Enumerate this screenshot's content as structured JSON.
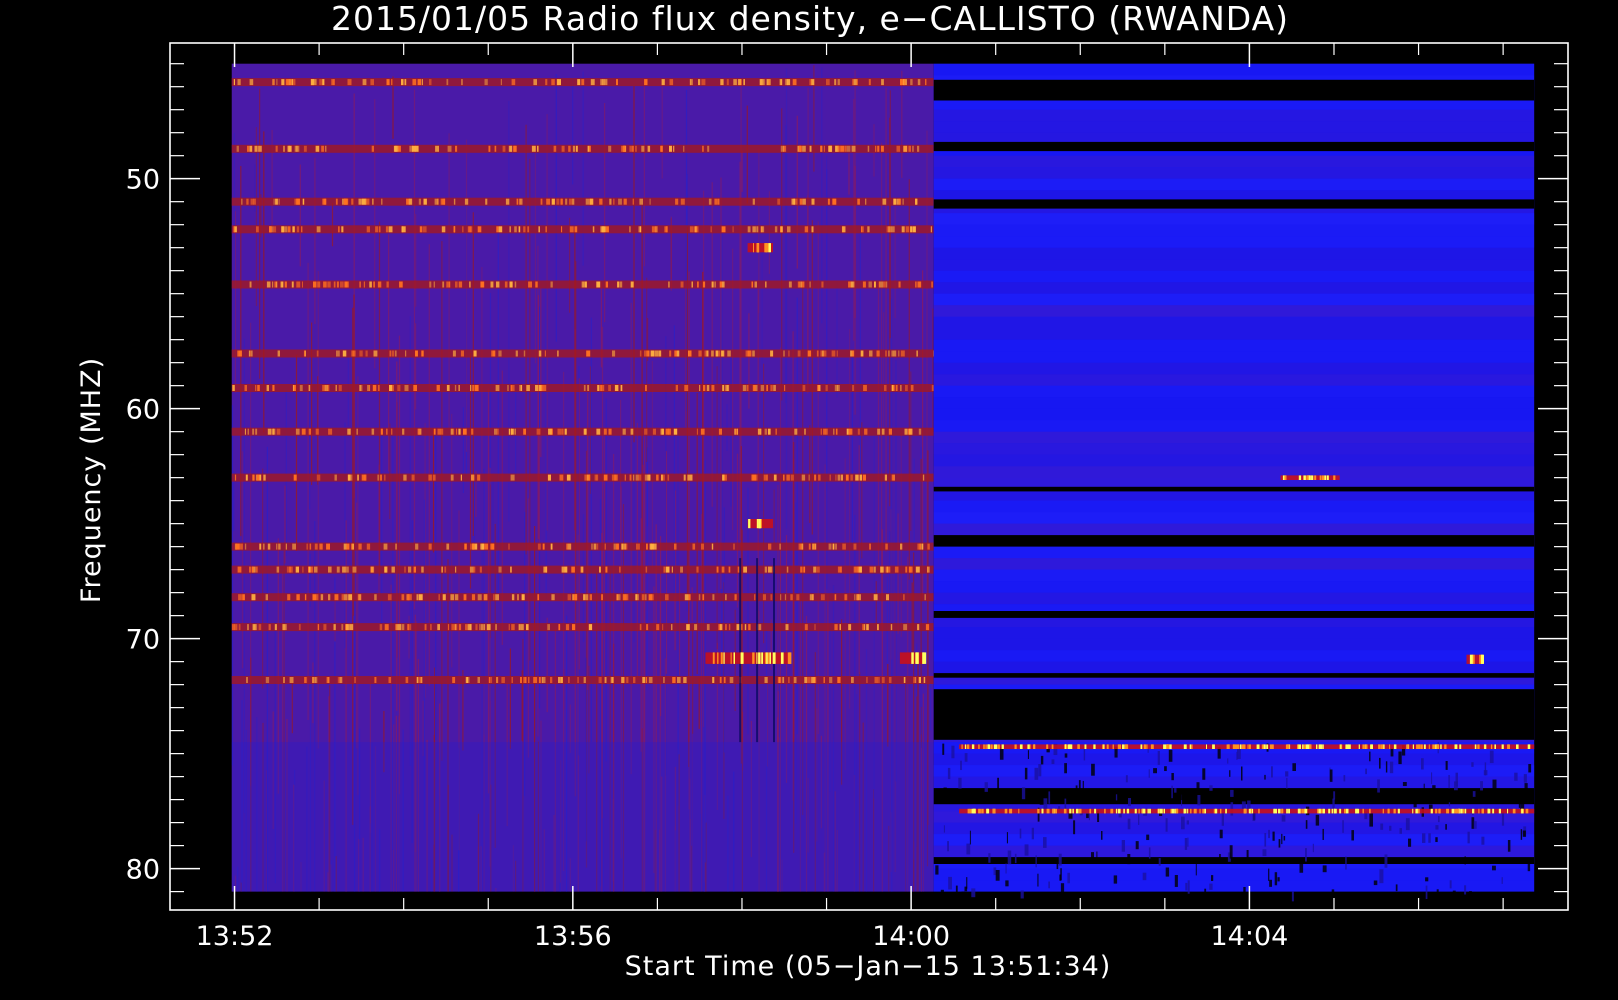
{
  "chart_data": {
    "type": "heatmap",
    "title": "2015/01/05  Radio flux density, e−CALLISTO (RWANDA)",
    "xlabel": "Start Time (05−Jan−15 13:51:34)",
    "ylabel": "Frequency (MHZ)",
    "x_ticks": [
      {
        "label": "13:52",
        "minutes": 0.433
      },
      {
        "label": "13:56",
        "minutes": 4.433
      },
      {
        "label": "14:00",
        "minutes": 8.433
      },
      {
        "label": "14:04",
        "minutes": 12.433
      }
    ],
    "y_ticks": [
      50,
      60,
      70,
      80
    ],
    "xlim_minutes": [
      -0.33,
      16.2
    ],
    "ylim": [
      44.1,
      81.8
    ],
    "y_inverted": true,
    "data_extent": {
      "t_start_minutes": 0.4,
      "t_end_minutes": 15.8,
      "f_min": 45.0,
      "f_max": 81.0,
      "segment_change_minutes": 8.7
    },
    "segments": [
      {
        "name": "segment-1",
        "t_range": [
          0.4,
          8.7
        ],
        "base_color": "#4a1aa8",
        "bright_bands_mhz": [
          45.8,
          48.7,
          51.0,
          52.2,
          54.6,
          57.6,
          59.1,
          61.0,
          63.0,
          66.0,
          67.0,
          68.2,
          69.5,
          71.8
        ],
        "hot_spots": [
          {
            "t": [
              6.0,
              7.0
            ],
            "f": [
              70.6,
              71.1
            ]
          },
          {
            "t": [
              8.3,
              8.6
            ],
            "f": [
              70.6,
              71.1
            ]
          },
          {
            "t": [
              6.5,
              6.8
            ],
            "f": [
              52.8,
              53.2
            ]
          },
          {
            "t": [
              6.5,
              6.8
            ],
            "f": [
              64.8,
              65.2
            ]
          }
        ]
      },
      {
        "name": "segment-2",
        "t_range": [
          8.7,
          15.8
        ],
        "base_color": "#1414f0",
        "dark_bands_mhz": [
          [
            45.7,
            46.6
          ],
          [
            48.4,
            48.8
          ],
          [
            50.9,
            51.3
          ],
          [
            63.4,
            63.6
          ],
          [
            65.5,
            66.0
          ],
          [
            68.8,
            69.1
          ],
          [
            71.5,
            71.7
          ],
          [
            72.2,
            74.4
          ],
          [
            76.5,
            77.2
          ],
          [
            79.5,
            79.8
          ]
        ],
        "hot_spots": [
          {
            "t": [
              12.8,
              13.5
            ],
            "f": [
              62.9,
              63.1
            ]
          },
          {
            "t": [
              15.0,
              15.2
            ],
            "f": [
              70.7,
              71.1
            ]
          },
          {
            "t": [
              9.0,
              15.8
            ],
            "f": [
              74.6,
              74.8
            ]
          },
          {
            "t": [
              9.0,
              15.8
            ],
            "f": [
              77.4,
              77.6
            ]
          }
        ]
      }
    ],
    "colormap": [
      "#000000",
      "#1010d0",
      "#5020b0",
      "#b01010",
      "#ff8000",
      "#ffff40"
    ],
    "grid": false,
    "legend": "none"
  }
}
